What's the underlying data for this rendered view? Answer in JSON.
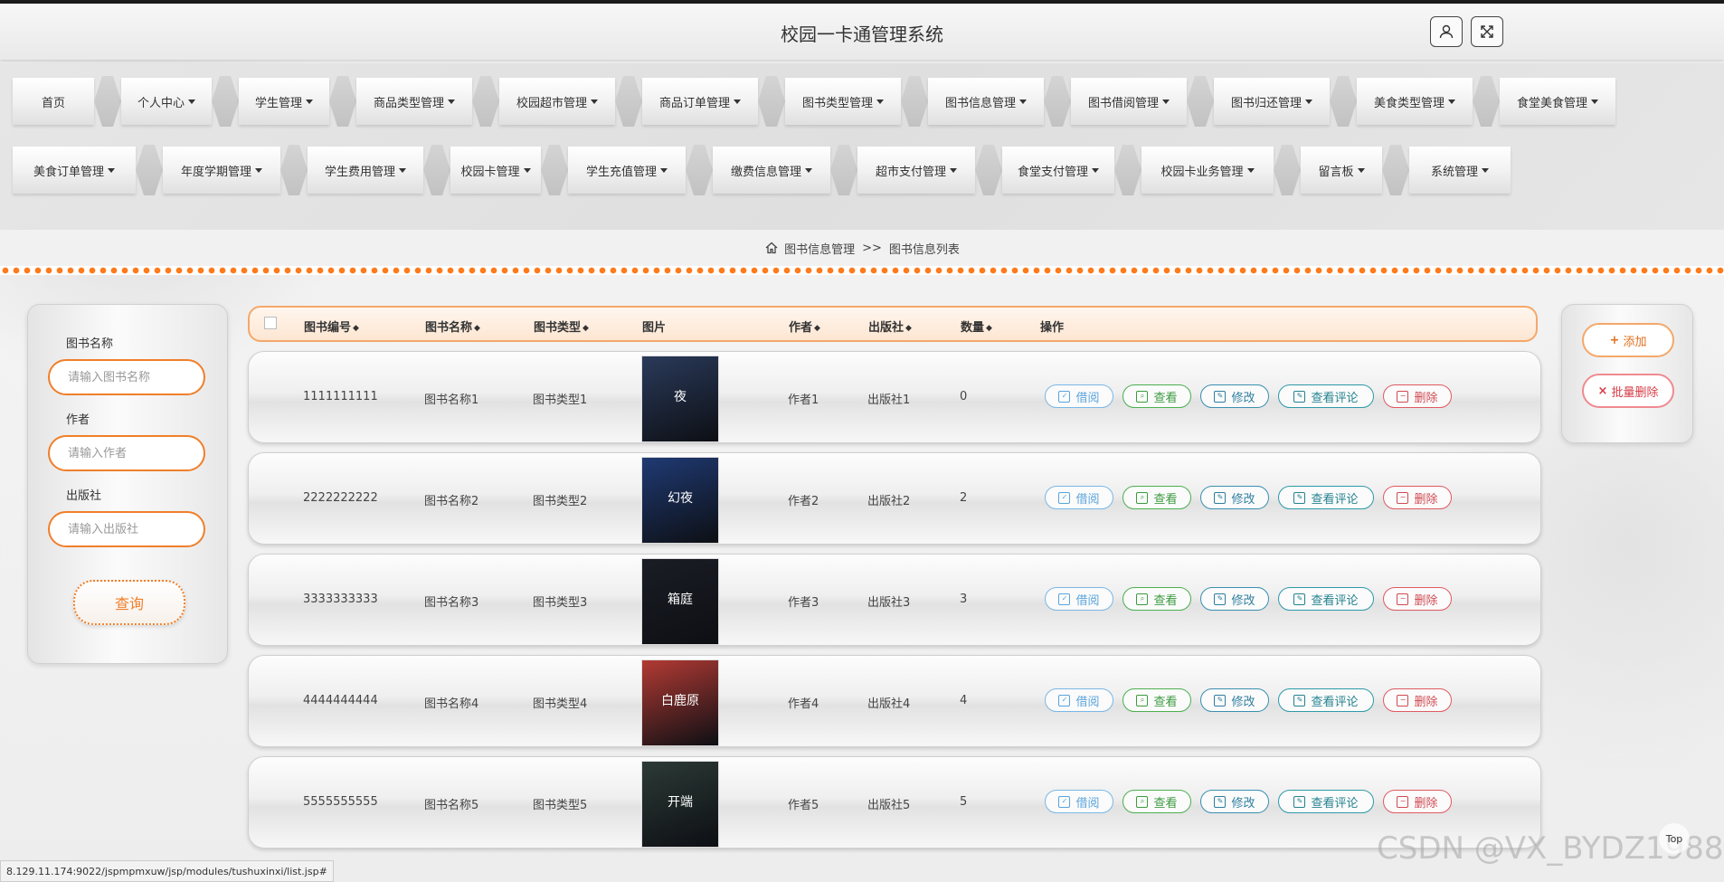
{
  "header": {
    "title": "校园一卡通管理系统",
    "user_icon": "user-icon",
    "fullscreen_icon": "fullscreen-icon"
  },
  "nav": {
    "row1": [
      {
        "label": "首页",
        "dropdown": false
      },
      {
        "label": "个人中心",
        "dropdown": true
      },
      {
        "label": "学生管理",
        "dropdown": true
      },
      {
        "label": "商品类型管理",
        "dropdown": true
      },
      {
        "label": "校园超市管理",
        "dropdown": true
      },
      {
        "label": "商品订单管理",
        "dropdown": true
      },
      {
        "label": "图书类型管理",
        "dropdown": true
      },
      {
        "label": "图书信息管理",
        "dropdown": true
      },
      {
        "label": "图书借阅管理",
        "dropdown": true
      },
      {
        "label": "图书归还管理",
        "dropdown": true
      },
      {
        "label": "美食类型管理",
        "dropdown": true
      },
      {
        "label": "食堂美食管理",
        "dropdown": true
      }
    ],
    "row2": [
      {
        "label": "美食订单管理",
        "dropdown": true
      },
      {
        "label": "年度学期管理",
        "dropdown": true
      },
      {
        "label": "学生费用管理",
        "dropdown": true
      },
      {
        "label": "校园卡管理",
        "dropdown": true
      },
      {
        "label": "学生充值管理",
        "dropdown": true
      },
      {
        "label": "缴费信息管理",
        "dropdown": true
      },
      {
        "label": "超市支付管理",
        "dropdown": true
      },
      {
        "label": "食堂支付管理",
        "dropdown": true
      },
      {
        "label": "校园卡业务管理",
        "dropdown": true
      },
      {
        "label": "留言板",
        "dropdown": true
      },
      {
        "label": "系统管理",
        "dropdown": true
      }
    ]
  },
  "breadcrumb": {
    "section": "图书信息管理",
    "separator": ">>",
    "page": "图书信息列表"
  },
  "search": {
    "name_label": "图书名称",
    "name_placeholder": "请输入图书名称",
    "author_label": "作者",
    "author_placeholder": "请输入作者",
    "publisher_label": "出版社",
    "publisher_placeholder": "请输入出版社",
    "query_label": "查询"
  },
  "table": {
    "headers": {
      "code": "图书编号",
      "name": "图书名称",
      "type": "图书类型",
      "image": "图片",
      "author": "作者",
      "publisher": "出版社",
      "quantity": "数量",
      "ops": "操作"
    },
    "sort_glyph": "◆",
    "rows": [
      {
        "code": "1111111111",
        "name": "图书名称1",
        "type": "图书类型1",
        "author": "作者1",
        "publisher": "出版社1",
        "quantity": "0",
        "cover_color": "#2a3a5a",
        "cover_text": "夜"
      },
      {
        "code": "2222222222",
        "name": "图书名称2",
        "type": "图书类型2",
        "author": "作者2",
        "publisher": "出版社2",
        "quantity": "2",
        "cover_color": "#1f3a73",
        "cover_text": "幻夜"
      },
      {
        "code": "3333333333",
        "name": "图书名称3",
        "type": "图书类型3",
        "author": "作者3",
        "publisher": "出版社3",
        "quantity": "3",
        "cover_color": "#1a1d24",
        "cover_text": "箱庭"
      },
      {
        "code": "4444444444",
        "name": "图书名称4",
        "type": "图书类型4",
        "author": "作者4",
        "publisher": "出版社4",
        "quantity": "4",
        "cover_color": "#b23a34",
        "cover_text": "白鹿原"
      },
      {
        "code": "5555555555",
        "name": "图书名称5",
        "type": "图书类型5",
        "author": "作者5",
        "publisher": "出版社5",
        "quantity": "5",
        "cover_color": "#2c3a36",
        "cover_text": "开端"
      }
    ],
    "actions": {
      "borrow": "借阅",
      "view": "查看",
      "edit": "修改",
      "comment": "查看评论",
      "delete": "删除"
    }
  },
  "right_panel": {
    "add_label": "添加",
    "batch_delete_label": "批量删除"
  },
  "status_url": "8.129.11.174:9022/jspmpmxuw/jsp/modules/tushuxinxi/list.jsp#",
  "watermark": "CSDN @VX_BYDZ1988",
  "top_label": "Top",
  "colors": {
    "accent": "#f07f2a",
    "danger": "#d63c46",
    "view": "#3c9a40",
    "borrow": "#5aa4dc"
  }
}
